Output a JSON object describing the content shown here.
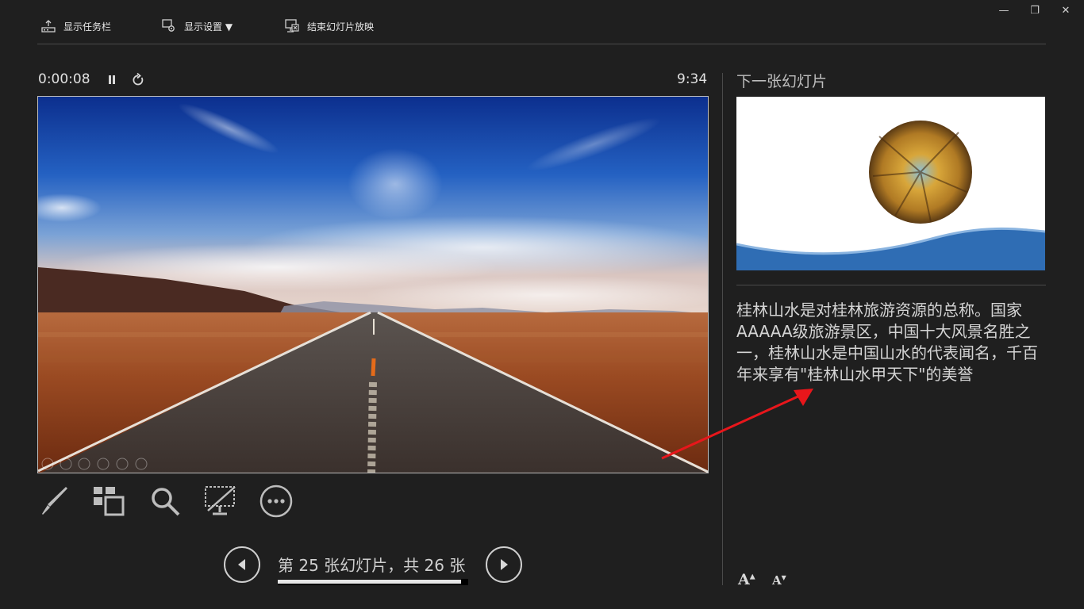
{
  "window_controls": {
    "minimize": "—",
    "restore": "❐",
    "close": "✕"
  },
  "toolbar": {
    "show_taskbar": "显示任务栏",
    "display_settings": "显示设置 ▼",
    "end_show": "结束幻灯片放映"
  },
  "timer": {
    "elapsed": "0:00:08",
    "clock": "9:34"
  },
  "slide_tools": [
    "pen-tool",
    "see-all-slides",
    "zoom",
    "black-screen",
    "more-options"
  ],
  "navigation": {
    "counter_text": "第 25 张幻灯片，共 26 张",
    "progress": 0.962
  },
  "next_slide": {
    "label": "下一张幻灯片"
  },
  "notes": {
    "text": "桂林山水是对桂林旅游资源的总称。国家AAAAA级旅游景区，中国十大风景名胜之一，桂林山水是中国山水的代表闻名，千百年来享有\"桂林山水甲天下\"的美誉"
  },
  "font_controls": {
    "increase": "A",
    "decrease": "A"
  },
  "colors": {
    "background": "#1f1f1f",
    "annotation_arrow": "#e8161b",
    "wave_blue": "#2f6db4"
  }
}
